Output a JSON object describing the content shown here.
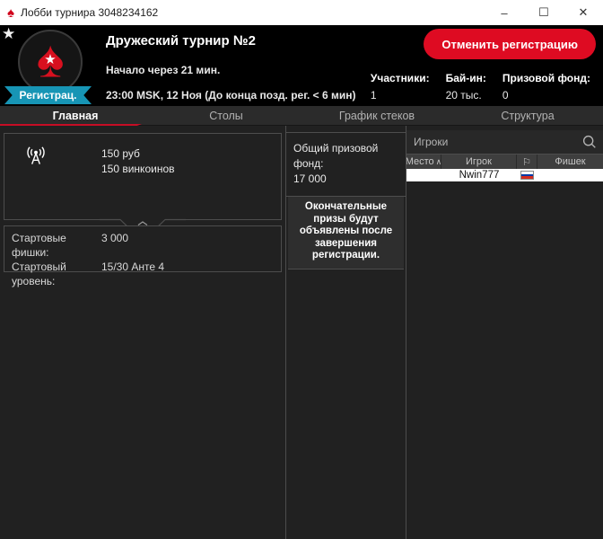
{
  "window": {
    "title": "Лобби турнира 3048234162"
  },
  "icons": {
    "app_spade": "♠",
    "favorite": "★",
    "logo_star": "★",
    "minimize": "–",
    "maximize": "☐",
    "close": "✕",
    "sort_asc": "∧",
    "flag_header": "⚐"
  },
  "header": {
    "tournament_name": "Дружеский турнир №2",
    "starts_in": "Начало через 21 мин.",
    "schedule": "23:00 MSK, 12 Ноя (До конца позд. рег. < 6 мин)",
    "status_badge": "Регистрац.",
    "cancel_button": "Отменить регистрацию",
    "stats": [
      {
        "label": "Участники:",
        "value": "1"
      },
      {
        "label": "Бай-ин:",
        "value": "20 тыс."
      },
      {
        "label": "Призовой фонд:",
        "value": "0"
      }
    ]
  },
  "tabs": [
    {
      "label": "Главная",
      "active": true
    },
    {
      "label": "Столы",
      "active": false
    },
    {
      "label": "График стеков",
      "active": false
    },
    {
      "label": "Структура",
      "active": false
    }
  ],
  "main": {
    "prize_box": {
      "line1": "150 руб",
      "line2": "150 винкоинов"
    },
    "start_info": [
      {
        "label": "Стартовые фишки:",
        "value": "3 000"
      },
      {
        "label": "Стартовый уровень:",
        "value": "15/30 Анте 4"
      }
    ],
    "prize_pool": {
      "label": "Общий призовой фонд:",
      "value": "17 000"
    },
    "prize_notice": "Окончательные призы будут объявлены после завершения регистрации."
  },
  "players": {
    "search_placeholder": "Игроки",
    "columns": [
      "Место",
      "Игрок",
      "",
      "Фишек"
    ],
    "rows": [
      {
        "place": "",
        "player": "Nwin777",
        "country": "ru-flag",
        "chips": ""
      }
    ]
  },
  "colors": {
    "accent_red": "#de0b22",
    "tab_underline_red": "#c60d25",
    "badge_teal": "#1795b5",
    "header_black": "#000000",
    "content_bg": "#212121",
    "box_border": "#4d4d4d",
    "row_bg": "#ffffff",
    "flag_blue": "#0039a6",
    "flag_red": "#d52b1e"
  }
}
